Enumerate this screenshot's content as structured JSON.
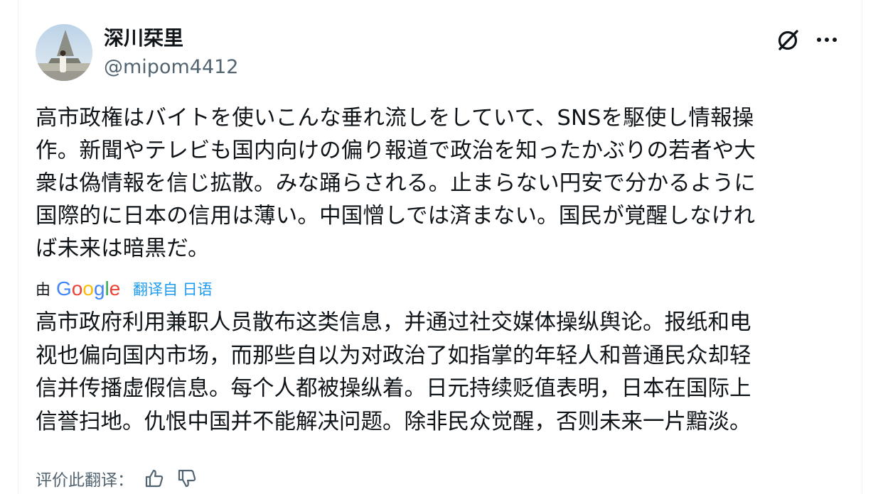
{
  "author": {
    "display_name": "深川栞里",
    "handle": "@mipom4412"
  },
  "icons": {
    "grok": "grok-icon",
    "more": "more-icon",
    "google_logo": "google-logo",
    "thumbs_up": "thumbs-up-icon",
    "thumbs_down": "thumbs-down-icon"
  },
  "post": {
    "original_text": "高市政権はバイトを使いこんな垂れ流しをしていて、SNSを駆使し情報操\n作。新聞やテレビも国内向けの偏り報道で政治を知ったかぶりの若者や大\n衆は偽情報を信じ拡散。みな踊らされる。止まらない円安で分かるように\n国際的に日本の信用は薄い。中国憎しでは済まない。国民が覚醒しなけれ\nば未来は暗黒だ。",
    "translated_by_prefix": "由",
    "google_wordmark": "Google",
    "translated_from_link": "翻译自 日语",
    "translated_text": "高市政府利用兼职人员散布这类信息，并通过社交媒体操纵舆论。报纸和电\n视也偏向国内市场，而那些自以为对政治了如指掌的年轻人和普通民众却轻\n信并传播虚假信息。每个人都被操纵着。日元持续贬值表明，日本在国际上\n信誉扫地。仇恨中国并不能解决问题。除非民众觉醒，否则未来一片黯淡。",
    "rate_translation_label": "评价此翻译："
  },
  "colors": {
    "text_primary": "#0f1419",
    "text_secondary": "#536471",
    "link": "#1d9bf0",
    "border": "#eff3f4"
  }
}
